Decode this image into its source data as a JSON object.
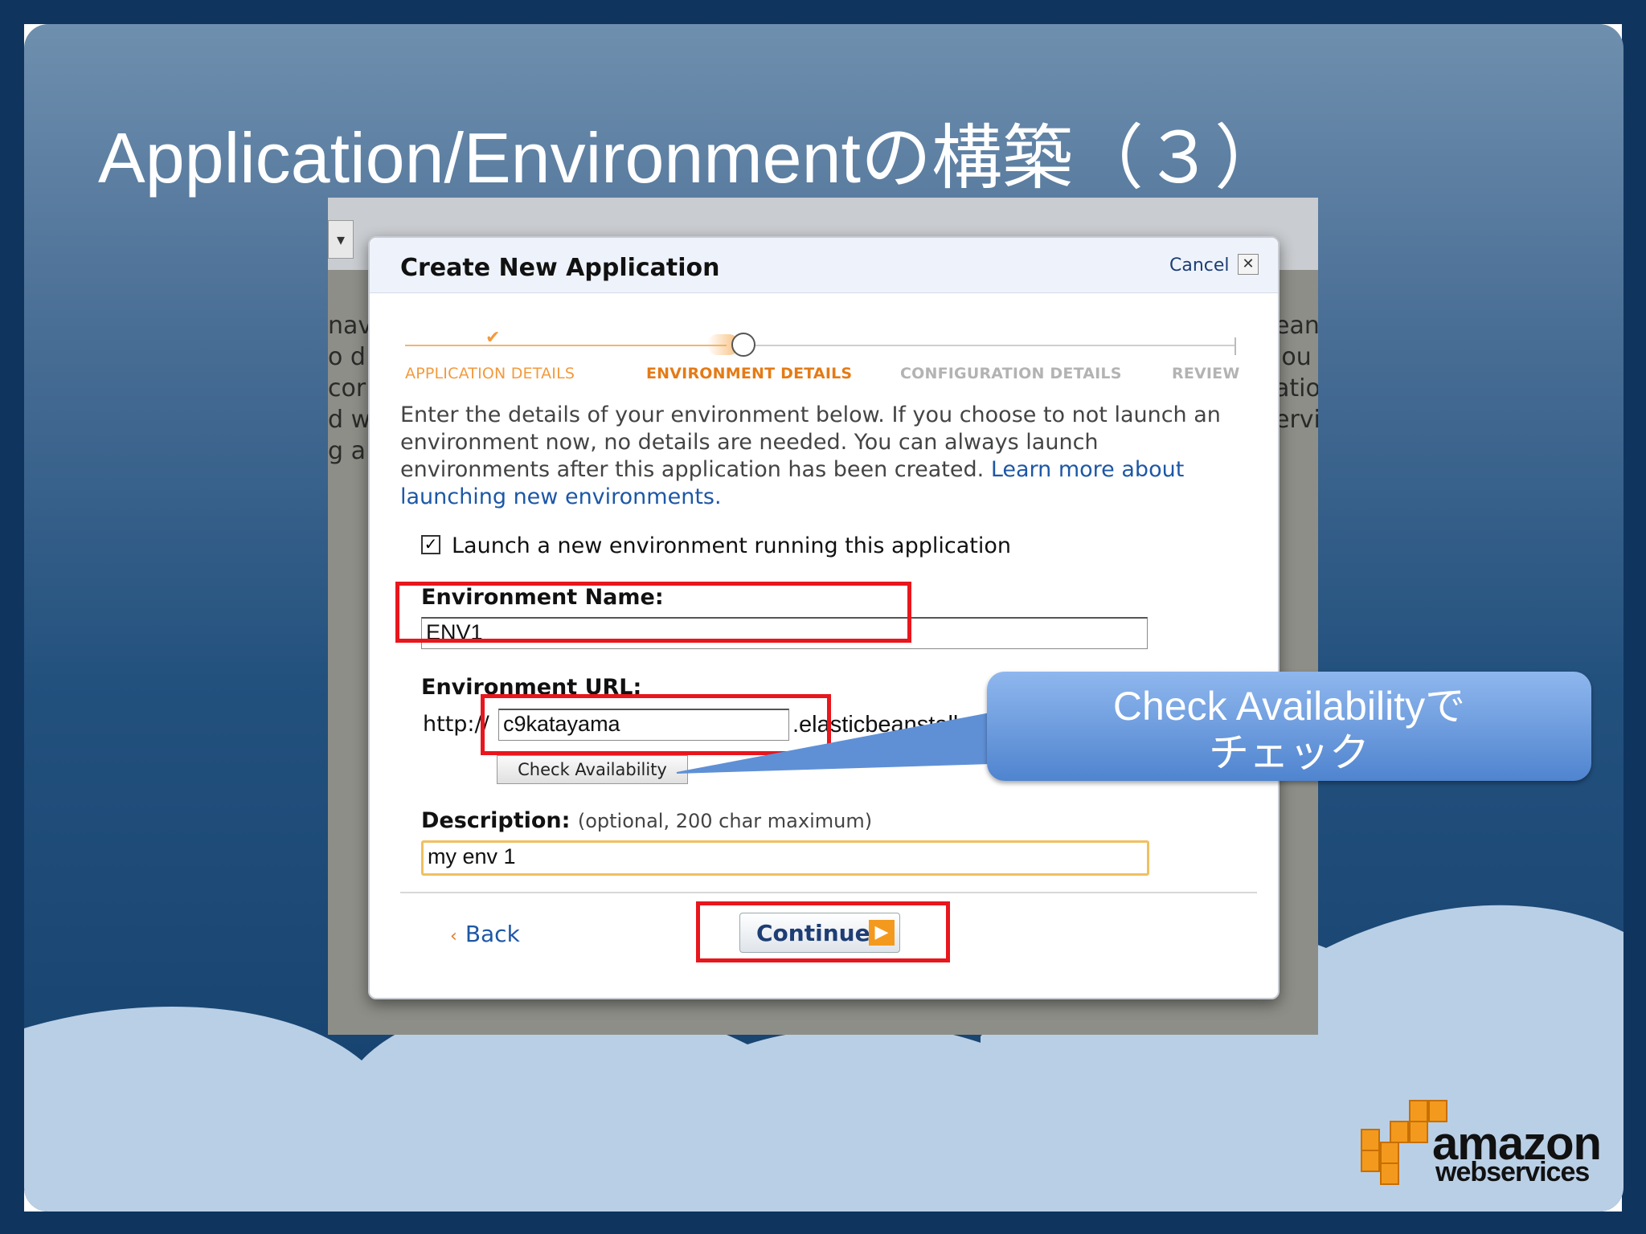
{
  "slide": {
    "title": "Application/Environmentの構築（３）"
  },
  "background_screen": {
    "lines_left": [
      "nav",
      "o d",
      "cor",
      "d w",
      "g a"
    ],
    "lines_right": [
      "eans",
      "lou",
      "atio",
      "ervi"
    ]
  },
  "dialog": {
    "title": "Create New Application",
    "cancel_label": "Cancel",
    "close_glyph": "✕",
    "steps": [
      {
        "label": "APPLICATION DETAILS",
        "state": "done"
      },
      {
        "label": "ENVIRONMENT DETAILS",
        "state": "current"
      },
      {
        "label": "CONFIGURATION DETAILS",
        "state": "upcoming"
      },
      {
        "label": "REVIEW",
        "state": "upcoming"
      }
    ],
    "intro_text": "Enter the details of your environment below. If you choose to not launch an environment now, no details are needed. You can always launch environments after this application has been created. ",
    "intro_link": "Learn more about launching new environments.",
    "launch_checkbox": {
      "checked": true,
      "label": "Launch a new environment running this application"
    },
    "env_name": {
      "label": "Environment Name:",
      "value": "ENV1"
    },
    "env_url": {
      "label": "Environment URL:",
      "prefix": "http://",
      "value": "c9katayama",
      "suffix": ".elasticbeanstalk",
      "check_button": "Check Availability"
    },
    "description": {
      "label": "Description:",
      "note": "(optional, 200 char maximum)",
      "value": "my env 1"
    },
    "back_label": "Back",
    "continue_label": "Continue"
  },
  "callout": {
    "line1": "Check Availabilityで",
    "line2": "チェック"
  },
  "logo": {
    "brand": "amazon",
    "sub": "webservices"
  },
  "colors": {
    "slide_bg": "#23517e",
    "cloud": "#b9cfe6",
    "highlight_red": "#e8161d",
    "step_active": "#e47b16",
    "step_done": "#f39a3d",
    "step_inactive": "#b3b3b3",
    "link": "#1d57a6",
    "callout_blue": "#5b8fd8",
    "aws_orange": "#f39a1e"
  }
}
